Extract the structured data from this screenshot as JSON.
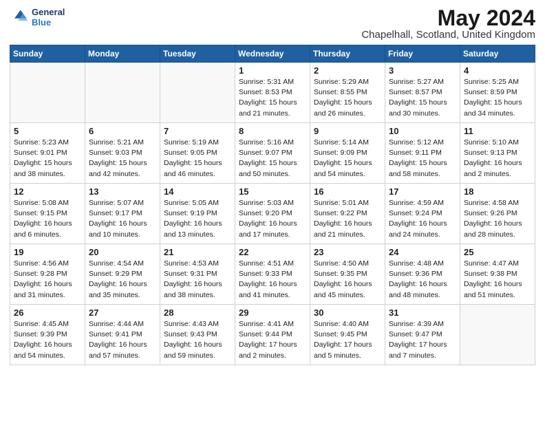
{
  "header": {
    "logo_line1": "General",
    "logo_line2": "Blue",
    "month_year": "May 2024",
    "location": "Chapelhall, Scotland, United Kingdom"
  },
  "days_of_week": [
    "Sunday",
    "Monday",
    "Tuesday",
    "Wednesday",
    "Thursday",
    "Friday",
    "Saturday"
  ],
  "weeks": [
    [
      {
        "day": "",
        "info": ""
      },
      {
        "day": "",
        "info": ""
      },
      {
        "day": "",
        "info": ""
      },
      {
        "day": "1",
        "info": "Sunrise: 5:31 AM\nSunset: 8:53 PM\nDaylight: 15 hours\nand 21 minutes."
      },
      {
        "day": "2",
        "info": "Sunrise: 5:29 AM\nSunset: 8:55 PM\nDaylight: 15 hours\nand 26 minutes."
      },
      {
        "day": "3",
        "info": "Sunrise: 5:27 AM\nSunset: 8:57 PM\nDaylight: 15 hours\nand 30 minutes."
      },
      {
        "day": "4",
        "info": "Sunrise: 5:25 AM\nSunset: 8:59 PM\nDaylight: 15 hours\nand 34 minutes."
      }
    ],
    [
      {
        "day": "5",
        "info": "Sunrise: 5:23 AM\nSunset: 9:01 PM\nDaylight: 15 hours\nand 38 minutes."
      },
      {
        "day": "6",
        "info": "Sunrise: 5:21 AM\nSunset: 9:03 PM\nDaylight: 15 hours\nand 42 minutes."
      },
      {
        "day": "7",
        "info": "Sunrise: 5:19 AM\nSunset: 9:05 PM\nDaylight: 15 hours\nand 46 minutes."
      },
      {
        "day": "8",
        "info": "Sunrise: 5:16 AM\nSunset: 9:07 PM\nDaylight: 15 hours\nand 50 minutes."
      },
      {
        "day": "9",
        "info": "Sunrise: 5:14 AM\nSunset: 9:09 PM\nDaylight: 15 hours\nand 54 minutes."
      },
      {
        "day": "10",
        "info": "Sunrise: 5:12 AM\nSunset: 9:11 PM\nDaylight: 15 hours\nand 58 minutes."
      },
      {
        "day": "11",
        "info": "Sunrise: 5:10 AM\nSunset: 9:13 PM\nDaylight: 16 hours\nand 2 minutes."
      }
    ],
    [
      {
        "day": "12",
        "info": "Sunrise: 5:08 AM\nSunset: 9:15 PM\nDaylight: 16 hours\nand 6 minutes."
      },
      {
        "day": "13",
        "info": "Sunrise: 5:07 AM\nSunset: 9:17 PM\nDaylight: 16 hours\nand 10 minutes."
      },
      {
        "day": "14",
        "info": "Sunrise: 5:05 AM\nSunset: 9:19 PM\nDaylight: 16 hours\nand 13 minutes."
      },
      {
        "day": "15",
        "info": "Sunrise: 5:03 AM\nSunset: 9:20 PM\nDaylight: 16 hours\nand 17 minutes."
      },
      {
        "day": "16",
        "info": "Sunrise: 5:01 AM\nSunset: 9:22 PM\nDaylight: 16 hours\nand 21 minutes."
      },
      {
        "day": "17",
        "info": "Sunrise: 4:59 AM\nSunset: 9:24 PM\nDaylight: 16 hours\nand 24 minutes."
      },
      {
        "day": "18",
        "info": "Sunrise: 4:58 AM\nSunset: 9:26 PM\nDaylight: 16 hours\nand 28 minutes."
      }
    ],
    [
      {
        "day": "19",
        "info": "Sunrise: 4:56 AM\nSunset: 9:28 PM\nDaylight: 16 hours\nand 31 minutes."
      },
      {
        "day": "20",
        "info": "Sunrise: 4:54 AM\nSunset: 9:29 PM\nDaylight: 16 hours\nand 35 minutes."
      },
      {
        "day": "21",
        "info": "Sunrise: 4:53 AM\nSunset: 9:31 PM\nDaylight: 16 hours\nand 38 minutes."
      },
      {
        "day": "22",
        "info": "Sunrise: 4:51 AM\nSunset: 9:33 PM\nDaylight: 16 hours\nand 41 minutes."
      },
      {
        "day": "23",
        "info": "Sunrise: 4:50 AM\nSunset: 9:35 PM\nDaylight: 16 hours\nand 45 minutes."
      },
      {
        "day": "24",
        "info": "Sunrise: 4:48 AM\nSunset: 9:36 PM\nDaylight: 16 hours\nand 48 minutes."
      },
      {
        "day": "25",
        "info": "Sunrise: 4:47 AM\nSunset: 9:38 PM\nDaylight: 16 hours\nand 51 minutes."
      }
    ],
    [
      {
        "day": "26",
        "info": "Sunrise: 4:45 AM\nSunset: 9:39 PM\nDaylight: 16 hours\nand 54 minutes."
      },
      {
        "day": "27",
        "info": "Sunrise: 4:44 AM\nSunset: 9:41 PM\nDaylight: 16 hours\nand 57 minutes."
      },
      {
        "day": "28",
        "info": "Sunrise: 4:43 AM\nSunset: 9:43 PM\nDaylight: 16 hours\nand 59 minutes."
      },
      {
        "day": "29",
        "info": "Sunrise: 4:41 AM\nSunset: 9:44 PM\nDaylight: 17 hours\nand 2 minutes."
      },
      {
        "day": "30",
        "info": "Sunrise: 4:40 AM\nSunset: 9:45 PM\nDaylight: 17 hours\nand 5 minutes."
      },
      {
        "day": "31",
        "info": "Sunrise: 4:39 AM\nSunset: 9:47 PM\nDaylight: 17 hours\nand 7 minutes."
      },
      {
        "day": "",
        "info": ""
      }
    ]
  ]
}
